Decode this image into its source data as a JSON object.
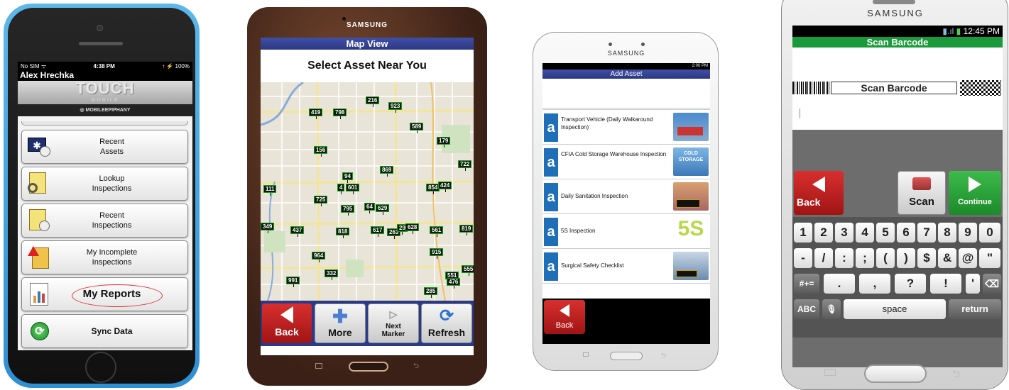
{
  "iphone": {
    "status_left": "No SIM ᯤ",
    "status_time": "4:38 PM",
    "status_right": "↑ ⚡ 100%",
    "user": "Alex Hrechka",
    "logo_main": "TOUCH",
    "logo_sub": "MOBILE",
    "brand": "MOBILEEPIPHANY",
    "menu": [
      {
        "label": "Recent\nAssets",
        "icon": "asset-clock-icon"
      },
      {
        "label": "Lookup\nInspections",
        "icon": "clipboard-search-icon"
      },
      {
        "label": "Recent\nInspections",
        "icon": "clipboard-clock-icon"
      },
      {
        "label": "My Incomplete\nInspections",
        "icon": "clipboard-warning-icon"
      },
      {
        "label": "My Reports",
        "icon": "reports-icon"
      },
      {
        "label": "Sync Data",
        "icon": "sync-icon"
      }
    ]
  },
  "tablet": {
    "brand": "SAMSUNG",
    "title": "Map View",
    "heading": "Select Asset Near You",
    "markers": [
      "216",
      "923",
      "419",
      "798",
      "589",
      "179",
      "156",
      "722",
      "869",
      "94",
      "854",
      "424",
      "111",
      "4",
      "601",
      "725",
      "795",
      "64",
      "629",
      "437",
      "818",
      "617",
      "263",
      "29",
      "628",
      "561",
      "819",
      "349",
      "915",
      "964",
      "332",
      "551",
      "991",
      "285",
      "476",
      "555"
    ],
    "buttons": {
      "back": "Back",
      "more": "More",
      "next": "Next\nMarker",
      "refresh": "Refresh"
    }
  },
  "phone3": {
    "brand": "SAMSUNG",
    "status": "2:00 PM",
    "title": "Add Asset",
    "items": [
      {
        "name": "Transport Vehicle (Daily Walkaround Inspection)"
      },
      {
        "name": "CFIA Cold Storage Warehouse Inspection"
      },
      {
        "name": "Daily Sanitation Inspection"
      },
      {
        "name": "5S Inspection"
      },
      {
        "name": "Surgical Safety Checklist"
      }
    ],
    "thumb_text": [
      "",
      "COLD STORAGE",
      "",
      "5S",
      ""
    ],
    "back": "Back",
    "a_letter": "a"
  },
  "galaxy": {
    "brand": "SAMSUNG",
    "status_time": "12:45 PM",
    "title": "Scan Barcode",
    "barcode_label": "Scan Barcode",
    "buttons": {
      "back": "Back",
      "scan": "Scan",
      "continue": "Continue"
    },
    "keys_row1": [
      "1",
      "2",
      "3",
      "4",
      "5",
      "6",
      "7",
      "8",
      "9",
      "0"
    ],
    "keys_row2": [
      "-",
      "/",
      ":",
      ";",
      "(",
      ")",
      "$",
      "&",
      "@",
      "\""
    ],
    "keys_row3": [
      "#+=",
      ".",
      ",",
      "?",
      "!",
      "'",
      "⌫"
    ],
    "keys_row4": {
      "abc": "ABC",
      "space": "space",
      "return": "return"
    }
  }
}
